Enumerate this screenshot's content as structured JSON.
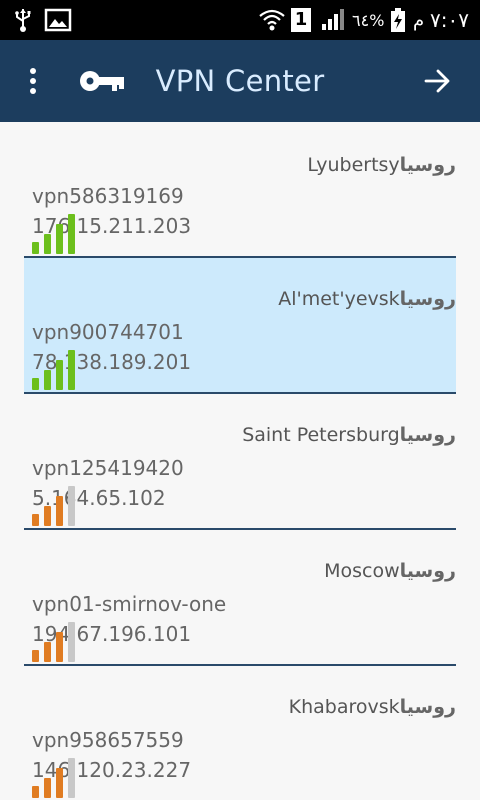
{
  "status_bar": {
    "battery_percent": "٦٤%",
    "sim": "1",
    "time": "٧:٠٧",
    "period": "م"
  },
  "app_bar": {
    "title": "VPN Center"
  },
  "servers": [
    {
      "city": "Lyubertsy",
      "country": "روسيا",
      "host": "vpn586319169",
      "ip": "176.15.211.203",
      "signal": 4,
      "signal_color": "#6cbf1c",
      "selected": false
    },
    {
      "city": "Al'met'yevsk",
      "country": "روسيا",
      "host": "vpn900744701",
      "ip": "78.138.189.201",
      "signal": 4,
      "signal_color": "#6cbf1c",
      "selected": true
    },
    {
      "city": "Saint Petersburg",
      "country": "روسيا",
      "host": "vpn125419420",
      "ip": "5.164.65.102",
      "signal": 3,
      "signal_color": "#e07c22",
      "selected": false
    },
    {
      "city": "Moscow",
      "country": "روسيا",
      "host": "vpn01-smirnov-one",
      "ip": "194.67.196.101",
      "signal": 3,
      "signal_color": "#e07c22",
      "selected": false
    },
    {
      "city": "Khabarovsk",
      "country": "روسيا",
      "host": "vpn958657559",
      "ip": "146.120.23.227",
      "signal": 3,
      "signal_color": "#e07c22",
      "selected": false
    }
  ],
  "colors": {
    "app_bar": "#1c3d5e",
    "selected_row": "#cdeafc",
    "signal_empty": "#c8c8c8"
  }
}
